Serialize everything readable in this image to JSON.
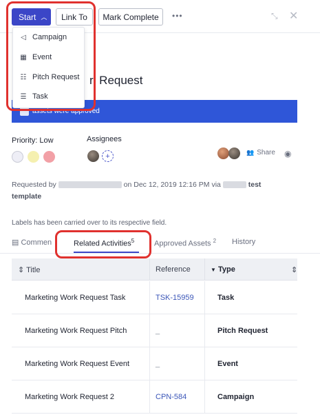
{
  "toolbar": {
    "start_label": "Start",
    "link_to_label": "Link To",
    "mark_complete_label": "Mark Complete",
    "more_label": "•••"
  },
  "start_menu": {
    "items": [
      {
        "label": "Campaign",
        "icon": "megaphone-icon"
      },
      {
        "label": "Event",
        "icon": "calendar-icon"
      },
      {
        "label": "Pitch Request",
        "icon": "checklist-icon"
      },
      {
        "label": "Task",
        "icon": "list-icon"
      }
    ]
  },
  "page": {
    "title_visible": "rl Request"
  },
  "banner": {
    "text": "assets were approved"
  },
  "details": {
    "priority_label": "Priority: Low",
    "assignees_label": "Assignees",
    "share_label": "Share",
    "priority_colors": [
      "#eeeef6",
      "#f5f0b0",
      "#f2a0a6"
    ]
  },
  "request": {
    "prefix": "Requested by",
    "middle": "on Dec 12, 2019 12:16 PM via",
    "suffix": "test",
    "line2": "template"
  },
  "labels_note": "Labels has been carried over to its respective field.",
  "tabs": [
    {
      "label": "Commen",
      "count": ""
    },
    {
      "label": "Related Activities",
      "count": "5"
    },
    {
      "label": "Approved Assets",
      "count": "2"
    },
    {
      "label": "History",
      "count": ""
    }
  ],
  "table": {
    "headers": [
      "Title",
      "Reference",
      "Type"
    ],
    "rows": [
      {
        "title": "Marketing Work Request Task",
        "reference": "TSK-15959",
        "type": "Task"
      },
      {
        "title": "Marketing Work Request Pitch",
        "reference": "_",
        "type": "Pitch Request"
      },
      {
        "title": "Marketing Work Request Event",
        "reference": "_",
        "type": "Event"
      },
      {
        "title": "Marketing Work Request 2",
        "reference": "CPN-584",
        "type": "Campaign"
      }
    ]
  },
  "colors": {
    "accent": "#3b46c7",
    "banner": "#2f56d8",
    "highlight": "#e0312e"
  }
}
